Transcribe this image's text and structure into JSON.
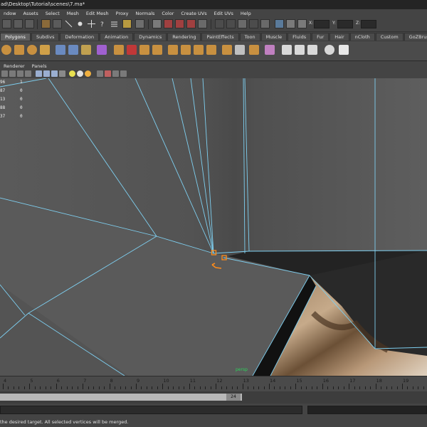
{
  "window": {
    "title": "ad\\Desktop\\Tutorial\\scenes\\7.ma*"
  },
  "menubar": {
    "items": [
      "ndow",
      "Assets",
      "Select",
      "Mesh",
      "Edit Mesh",
      "Proxy",
      "Normals",
      "Color",
      "Create UVs",
      "Edit UVs",
      "Help"
    ]
  },
  "statusline": {
    "x_label": "X:",
    "y_label": "Y:",
    "z_label": "Z:",
    "x_value": "",
    "y_value": "",
    "z_value": ""
  },
  "shelf_tabs": {
    "items": [
      "Polygons",
      "Subdivs",
      "Deformation",
      "Animation",
      "Dynamics",
      "Rendering",
      "PaintEffects",
      "Toon",
      "Muscle",
      "Fluids",
      "Fur",
      "Hair",
      "nCloth",
      "Custom",
      "GoZBrush"
    ],
    "active": "Polygons"
  },
  "panel_menu": {
    "items": [
      "Renderer",
      "Panels"
    ]
  },
  "hud": {
    "rows": [
      [
        "96",
        "1"
      ],
      [
        "87",
        "0"
      ],
      [
        "13",
        "0"
      ],
      [
        "88",
        "0"
      ],
      [
        "37",
        "0"
      ]
    ]
  },
  "viewport": {
    "camera_label": "persp",
    "selection_color": "#ff8c1a",
    "edge_color": "#7ecff0"
  },
  "timeline": {
    "ticks": [
      "4",
      "5",
      "6",
      "7",
      "8",
      "9",
      "10",
      "11",
      "12",
      "13",
      "14",
      "15",
      "16",
      "17",
      "18",
      "19"
    ],
    "current_frame": "24"
  },
  "helpline": {
    "text": "the desired target. All selected vertices will be merged."
  }
}
